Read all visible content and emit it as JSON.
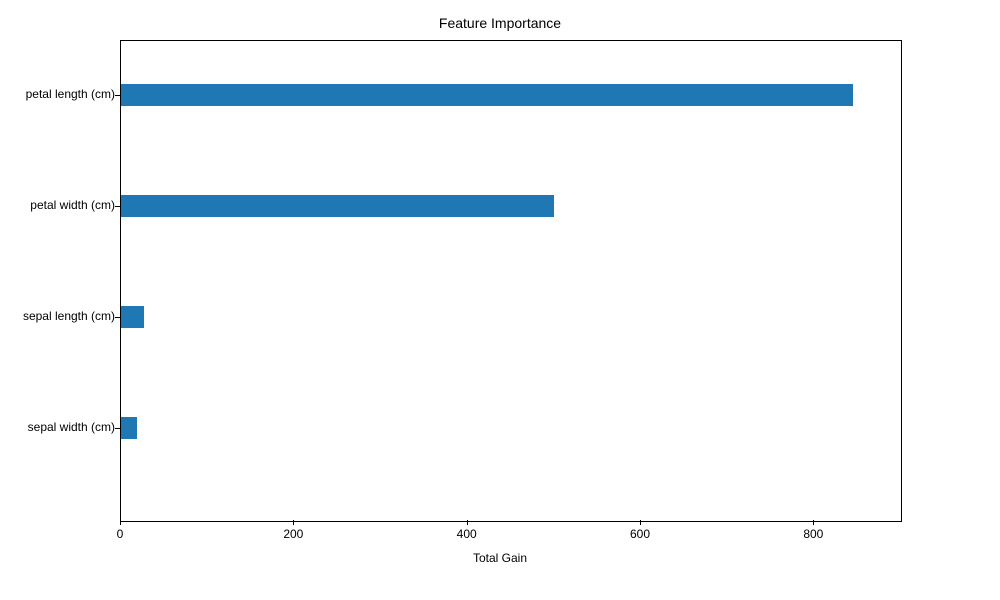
{
  "chart_data": {
    "type": "bar",
    "orientation": "horizontal",
    "title": "Feature Importance",
    "xlabel": "Total Gain",
    "ylabel": "",
    "categories": [
      "petal length (cm)",
      "petal width (cm)",
      "sepal length (cm)",
      "sepal width (cm)"
    ],
    "values": [
      845,
      500,
      27,
      19
    ],
    "xlim": [
      0,
      900
    ],
    "x_ticks": [
      0,
      200,
      400,
      600,
      800
    ],
    "color": "#1f77b4"
  }
}
